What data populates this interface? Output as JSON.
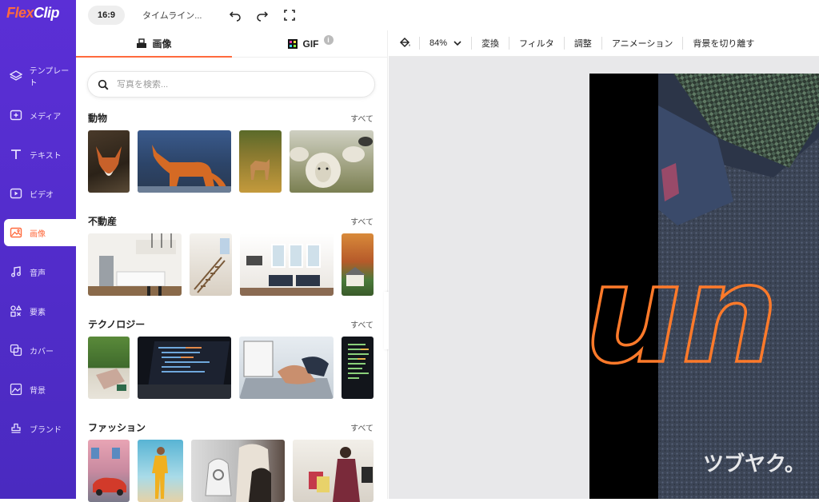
{
  "app": {
    "logo_flex": "Flex",
    "logo_clip": "Clip"
  },
  "topbar": {
    "ratio": "16:9",
    "timeline": "タイムライン..."
  },
  "sidebar": {
    "items": [
      {
        "label": "テンプレート",
        "icon": "layers-icon"
      },
      {
        "label": "メディア",
        "icon": "media-add-icon"
      },
      {
        "label": "テキスト",
        "icon": "text-icon"
      },
      {
        "label": "ビデオ",
        "icon": "video-icon"
      },
      {
        "label": "画像",
        "icon": "image-icon",
        "active": true
      },
      {
        "label": "音声",
        "icon": "music-note-icon"
      },
      {
        "label": "要素",
        "icon": "elements-icon"
      },
      {
        "label": "カバー",
        "icon": "cover-icon"
      },
      {
        "label": "背景",
        "icon": "background-icon"
      },
      {
        "label": "ブランド",
        "icon": "brand-stamp-icon"
      }
    ]
  },
  "panel": {
    "tabs": [
      {
        "label": "画像"
      },
      {
        "label": "GIF"
      }
    ],
    "info_glyph": "i",
    "search": {
      "placeholder": "写真を検索..."
    },
    "see_all": "すべて",
    "categories": [
      {
        "title": "動物"
      },
      {
        "title": "不動産"
      },
      {
        "title": "テクノロジー"
      },
      {
        "title": "ファッション"
      }
    ],
    "collapse_glyph": "‹"
  },
  "editor": {
    "toolbar": {
      "zoom": "84%",
      "items": [
        "変換",
        "フィルタ",
        "調整",
        "アニメーション",
        "背景を切り離す"
      ]
    },
    "canvas": {
      "text": "un",
      "watermark": "ツブヤク。"
    }
  },
  "colors": {
    "accent": "#ff6a3d",
    "sidebar": "#5b2fd6"
  }
}
